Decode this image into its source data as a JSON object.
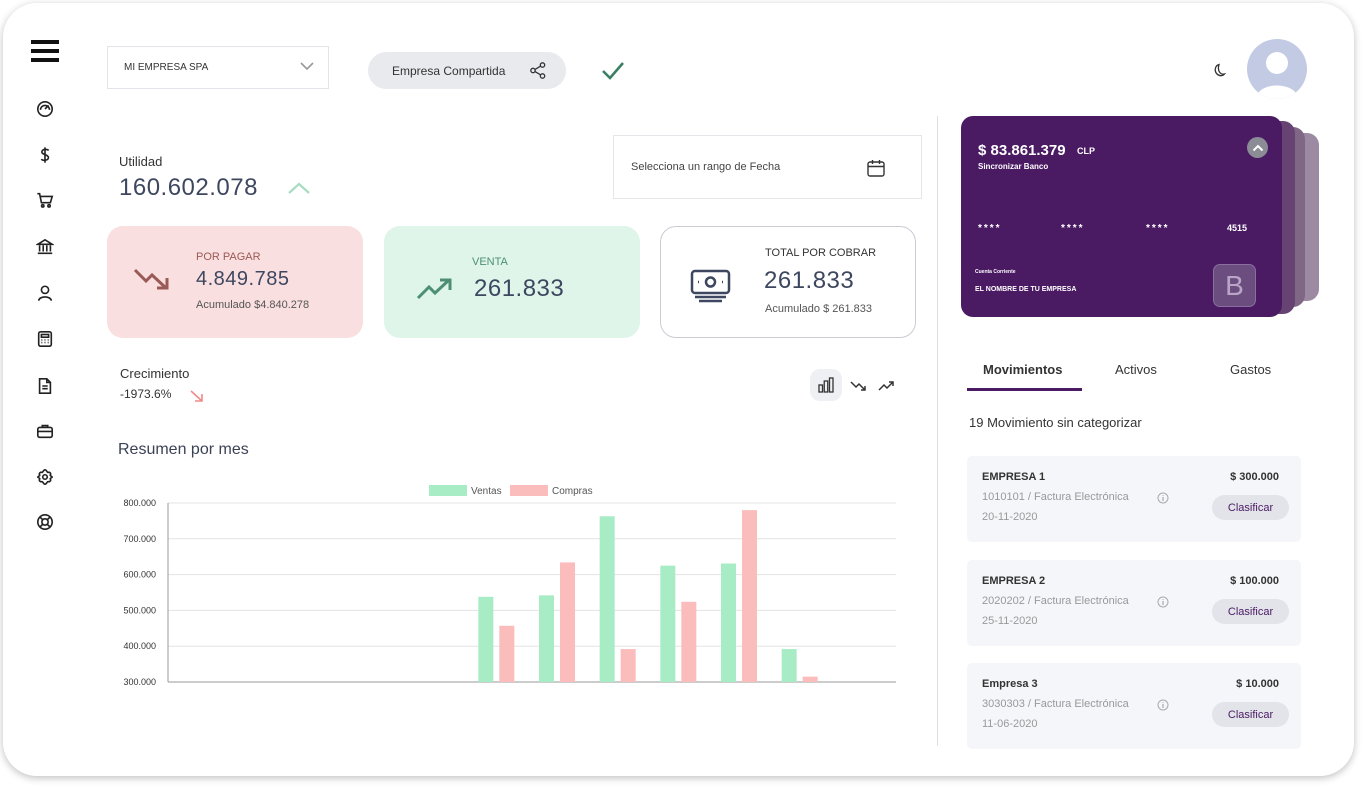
{
  "topbar": {
    "company": "MI EMPRESA SPA",
    "shared_label": "Empresa Compartida"
  },
  "summary": {
    "utilidad_label": "Utilidad",
    "utilidad_value": "160.602.078",
    "date_range_placeholder": "Selecciona un rango de Fecha"
  },
  "kpis": {
    "por_pagar": {
      "label": "POR PAGAR",
      "value": "4.849.785",
      "sub": "Acumulado $4.840.278"
    },
    "venta": {
      "label": "VENTA",
      "value": "261.833"
    },
    "total_por_cobrar": {
      "label": "TOTAL POR COBRAR",
      "value": "261.833",
      "sub": "Acumulado $ 261.833"
    }
  },
  "growth": {
    "label": "Crecimiento",
    "value": "-1973.6%"
  },
  "chart_section_title": "Resumen por mes",
  "chart_data": {
    "type": "bar",
    "title": "",
    "xlabel": "",
    "ylabel": "",
    "ylim": [
      300000,
      800000
    ],
    "yticks": [
      "800.000",
      "700.000",
      "600.000",
      "500.000",
      "400.000",
      "300.000"
    ],
    "legend_position": "top-center",
    "grid": true,
    "slots": 12,
    "series": [
      {
        "name": "Ventas",
        "color": "#a8ecc6",
        "values": [
          null,
          null,
          null,
          null,
          null,
          538000,
          542000,
          763000,
          625000,
          631000,
          392000,
          null
        ]
      },
      {
        "name": "Compras",
        "color": "#fbbcbc",
        "values": [
          null,
          null,
          null,
          null,
          null,
          457000,
          634000,
          392000,
          524000,
          780000,
          315000,
          null
        ]
      }
    ]
  },
  "bank_card": {
    "balance": "$ 83.861.379",
    "currency": "CLP",
    "sync_label": "Sincronizar Banco",
    "masked_groups": [
      "****",
      "****",
      "****"
    ],
    "last4": "4515",
    "account_type": "Cuenta Corriente",
    "owner": "EL NOMBRE DE TU EMPRESA",
    "bank_logo_letter": "B",
    "card_color": "#4a1a63"
  },
  "tabs": [
    "Movimientos",
    "Activos",
    "Gastos"
  ],
  "uncategorized_label": "19 Movimiento sin categorizar",
  "movements": [
    {
      "company": "EMPRESA 1",
      "amount": "$ 300.000",
      "detail": "1010101 / Factura Electrónica",
      "date": "20-11-2020",
      "action": "Clasificar"
    },
    {
      "company": "EMPRESA 2",
      "amount": "$ 100.000",
      "detail": "2020202 / Factura Electrónica",
      "date": "25-11-2020",
      "action": "Clasificar"
    },
    {
      "company": "Empresa 3",
      "amount": "$ 10.000",
      "detail": "3030303 / Factura Electrónica",
      "date": "11-06-2020",
      "action": "Clasificar"
    }
  ],
  "colors": {
    "brand": "#4a1a63",
    "pay_bg": "#fadfe0",
    "sale_bg": "#dff5ea",
    "check": "#3a7f63",
    "down_arrow": "#9a5a55",
    "up_arrow": "#4d8f73"
  }
}
